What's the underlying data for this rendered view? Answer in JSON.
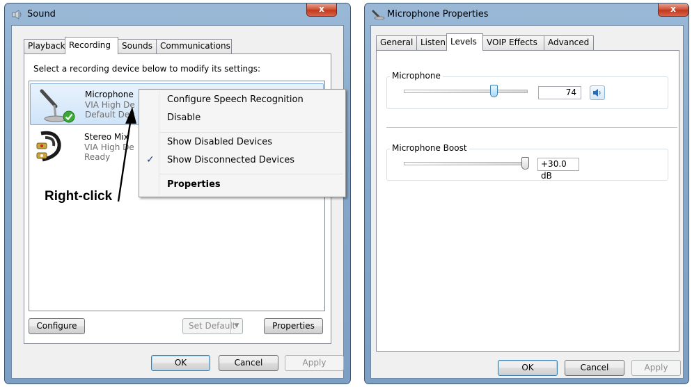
{
  "sound_dialog": {
    "title": "Sound",
    "close_glyph": "x",
    "tabs": [
      {
        "label": "Playback"
      },
      {
        "label": "Recording"
      },
      {
        "label": "Sounds"
      },
      {
        "label": "Communications"
      }
    ],
    "instruction": "Select a recording device below to modify its settings:",
    "devices": [
      {
        "name": "Microphone",
        "line1": "VIA High De",
        "line2": "Default Dev",
        "icon": "microphone-icon",
        "status_icon": "green-check-icon"
      },
      {
        "name": "Stereo Mix",
        "line1": "VIA High De",
        "line2": "Ready",
        "icon": "rca-cable-icon"
      }
    ],
    "buttons": {
      "configure": "Configure",
      "set_default": "Set Default",
      "properties": "Properties",
      "ok": "OK",
      "cancel": "Cancel",
      "apply": "Apply"
    },
    "context_menu": {
      "items": [
        {
          "label": "Configure Speech Recognition"
        },
        {
          "label": "Disable"
        },
        {
          "label": "Show Disabled Devices"
        },
        {
          "label": "Show Disconnected Devices",
          "check": "✓"
        },
        {
          "label": "Properties"
        }
      ]
    },
    "annotation": "Right-click"
  },
  "mic_properties": {
    "title": "Microphone Properties",
    "close_glyph": "x",
    "tabs": [
      {
        "label": "General"
      },
      {
        "label": "Listen"
      },
      {
        "label": "Levels"
      },
      {
        "label": "VOIP Effects"
      },
      {
        "label": "Advanced"
      }
    ],
    "microphone": {
      "label": "Microphone",
      "value": "74",
      "level_fraction": 0.74
    },
    "boost": {
      "label": "Microphone Boost",
      "value": "+30.0 dB",
      "level_fraction": 1.0
    },
    "buttons": {
      "ok": "OK",
      "cancel": "Cancel",
      "apply": "Apply"
    }
  },
  "colors": {
    "title_bar": "#86a8cb",
    "close_button": "#c9472b",
    "selection": "#cfe4f9",
    "check_green": "#3aa935"
  }
}
